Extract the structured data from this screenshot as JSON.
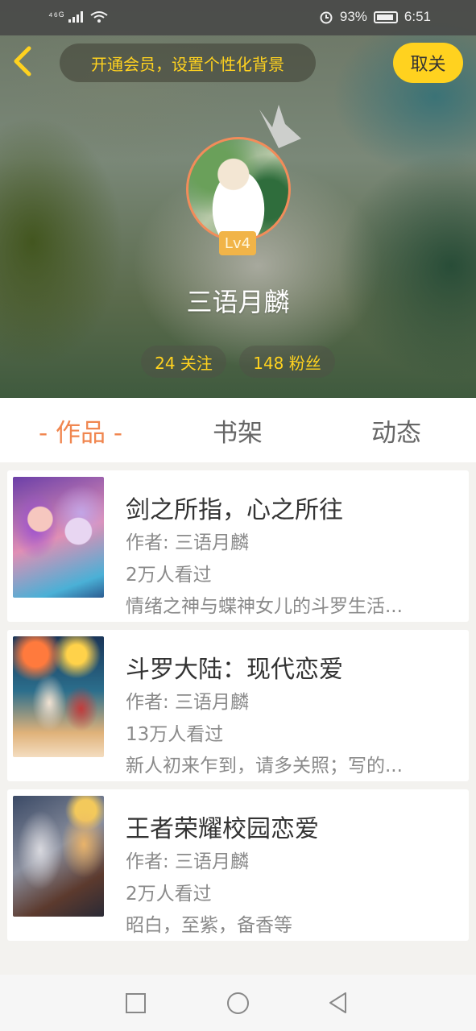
{
  "status_bar": {
    "network": "⁴⁶ᴳ",
    "battery_percent": "93%",
    "time": "6:51"
  },
  "header": {
    "vip_banner": "开通会员，设置个性化背景",
    "unfollow_label": "取关",
    "level": "Lv4",
    "username": "三语月麟",
    "follow_count_label": "24 关注",
    "fans_count_label": "148 粉丝"
  },
  "tabs": [
    {
      "label": "- 作品 -",
      "active": true
    },
    {
      "label": "书架",
      "active": false
    },
    {
      "label": "动态",
      "active": false
    }
  ],
  "works": [
    {
      "title": "剑之所指，心之所往",
      "author": "作者: 三语月麟",
      "views": "2万人看过",
      "description": "情绪之神与蝶神女儿的斗罗生活..."
    },
    {
      "title": "斗罗大陆：现代恋爱",
      "author": "作者: 三语月麟",
      "views": "13万人看过",
      "description": "新人初来乍到，请多关照；写的..."
    },
    {
      "title": "王者荣耀校园恋爱",
      "author": "作者: 三语月麟",
      "views": "2万人看过",
      "description": "昭白，至紫，备香等"
    }
  ],
  "colors": {
    "accent_yellow": "#ffd21f",
    "tab_active": "#f0864f",
    "level_badge": "#f1b448"
  }
}
